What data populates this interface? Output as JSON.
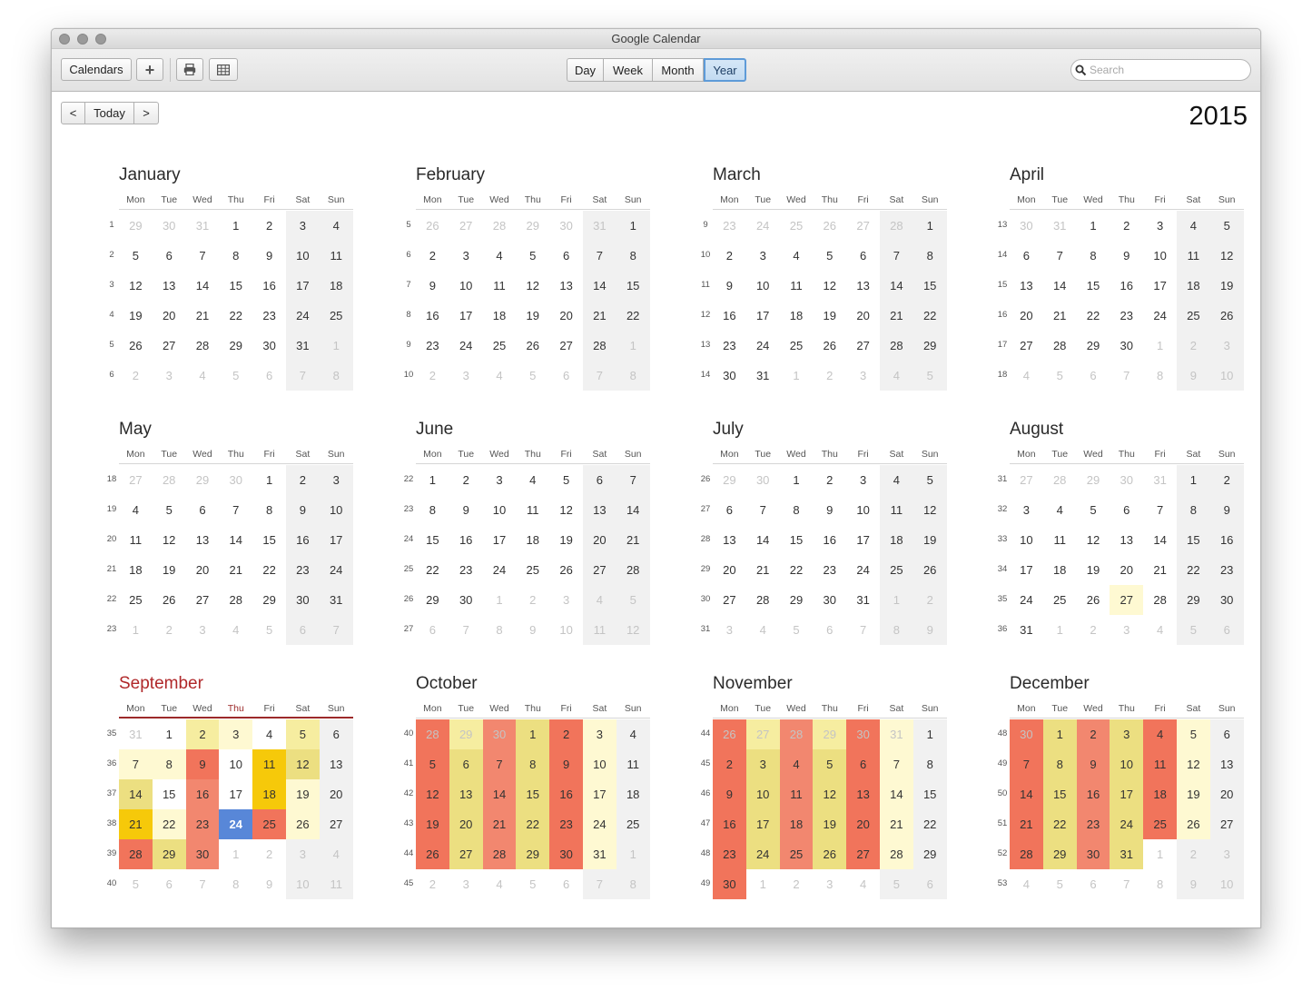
{
  "window": {
    "title": "Google Calendar"
  },
  "toolbar": {
    "calendars_label": "Calendars",
    "add_label": "+",
    "views": [
      "Day",
      "Week",
      "Month",
      "Year"
    ],
    "active_view": "Year",
    "search_placeholder": "Search"
  },
  "nav": {
    "prev": "<",
    "today": "Today",
    "next": ">"
  },
  "year": "2015",
  "weekdays": [
    "Mon",
    "Tue",
    "Wed",
    "Thu",
    "Fri",
    "Sat",
    "Sun"
  ],
  "today": {
    "month": 8,
    "day": 24
  },
  "colors": {
    "weekend_bg": "#f1f1f1",
    "today_bg": "#5887d8",
    "heat": {
      "1": "#fef9d2",
      "2": "#f6eda0",
      "3": "#ecdf81",
      "4": "#f3a182",
      "5": "#f2876f",
      "6": "#f1745b",
      "7": "#f6c90a"
    }
  },
  "months": [
    {
      "name": "January",
      "first_weeknum": 1,
      "days": 31,
      "offset": 3,
      "prev_days": 31
    },
    {
      "name": "February",
      "first_weeknum": 5,
      "days": 28,
      "offset": 6,
      "prev_days": 31
    },
    {
      "name": "March",
      "first_weeknum": 9,
      "days": 31,
      "offset": 6,
      "prev_days": 28
    },
    {
      "name": "April",
      "first_weeknum": 13,
      "days": 30,
      "offset": 2,
      "prev_days": 31
    },
    {
      "name": "May",
      "first_weeknum": 18,
      "days": 31,
      "offset": 4,
      "prev_days": 30
    },
    {
      "name": "June",
      "first_weeknum": 22,
      "days": 30,
      "offset": 0,
      "prev_days": 31
    },
    {
      "name": "July",
      "first_weeknum": 26,
      "days": 31,
      "offset": 2,
      "prev_days": 30
    },
    {
      "name": "August",
      "first_weeknum": 31,
      "days": 31,
      "offset": 5,
      "prev_days": 31,
      "heat": {
        "27": 1
      }
    },
    {
      "name": "September",
      "first_weeknum": 35,
      "days": 30,
      "offset": 1,
      "prev_days": 31,
      "current": true,
      "heat": {
        "2": 2,
        "3": 1,
        "5": 2,
        "7": 1,
        "8": 1,
        "9": 6,
        "11": 7,
        "12": 3,
        "14": 3,
        "16": 5,
        "18": 7,
        "19": 1,
        "21": 7,
        "22": 1,
        "23": 5,
        "25": 6,
        "26": 1,
        "28": 6,
        "29": 3,
        "30": 5
      }
    },
    {
      "name": "October",
      "first_weeknum": 40,
      "days": 31,
      "offset": 3,
      "prev_days": 30,
      "heat": {
        "p28": 6,
        "p29": 2,
        "p30": 5,
        "1": 3,
        "2": 6,
        "3": 1,
        "5": 6,
        "6": 3,
        "7": 5,
        "8": 3,
        "9": 6,
        "10": 1,
        "12": 6,
        "13": 3,
        "14": 5,
        "15": 3,
        "16": 6,
        "17": 1,
        "19": 6,
        "20": 3,
        "21": 5,
        "22": 3,
        "23": 6,
        "24": 1,
        "26": 6,
        "27": 3,
        "28": 5,
        "29": 3,
        "30": 6,
        "31": 1
      }
    },
    {
      "name": "November",
      "first_weeknum": 44,
      "days": 30,
      "offset": 6,
      "prev_days": 31,
      "heat": {
        "p26": 6,
        "p27": 2,
        "p28": 5,
        "p29": 2,
        "p30": 6,
        "p31": 1,
        "2": 6,
        "3": 3,
        "4": 5,
        "5": 3,
        "6": 6,
        "7": 1,
        "9": 6,
        "10": 3,
        "11": 5,
        "12": 3,
        "13": 6,
        "14": 1,
        "16": 6,
        "17": 3,
        "18": 5,
        "19": 3,
        "20": 6,
        "21": 1,
        "23": 6,
        "24": 3,
        "25": 5,
        "26": 3,
        "27": 6,
        "28": 1,
        "30": 6
      }
    },
    {
      "name": "December",
      "first_weeknum": 48,
      "days": 31,
      "offset": 1,
      "prev_days": 30,
      "heat": {
        "p30": 6,
        "1": 3,
        "2": 5,
        "3": 3,
        "4": 6,
        "5": 1,
        "7": 6,
        "8": 3,
        "9": 5,
        "10": 3,
        "11": 6,
        "12": 1,
        "14": 6,
        "15": 3,
        "16": 5,
        "17": 3,
        "18": 6,
        "19": 1,
        "21": 6,
        "22": 3,
        "23": 5,
        "24": 3,
        "25": 6,
        "26": 1,
        "28": 6,
        "29": 3,
        "30": 5,
        "31": 3
      }
    }
  ]
}
